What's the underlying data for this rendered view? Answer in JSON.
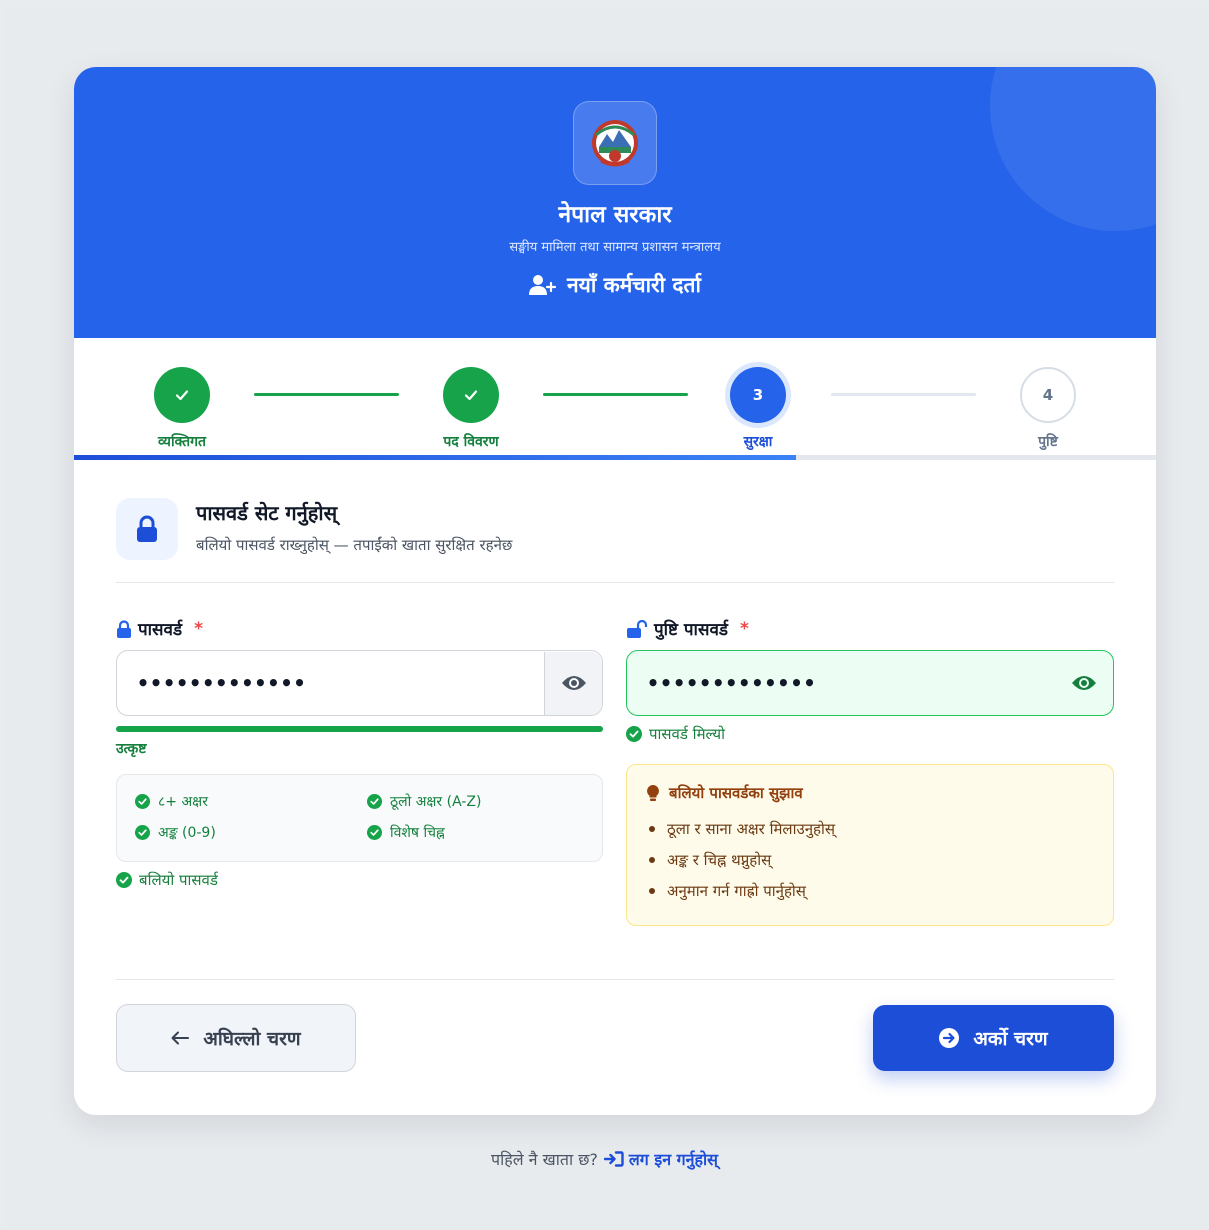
{
  "header": {
    "title": "नेपाल सरकार",
    "subtitle": "सङ्घीय मामिला तथा सामान्य प्रशासन मन्त्रालय",
    "registration_label": "नयाँ कर्मचारी दर्ता"
  },
  "stepper": {
    "progress_fraction": 0.667,
    "steps": [
      {
        "number": "1",
        "label": "व्यक्तिगत",
        "state": "done"
      },
      {
        "number": "2",
        "label": "पद विवरण",
        "state": "done"
      },
      {
        "number": "3",
        "label": "सुरक्षा",
        "state": "active"
      },
      {
        "number": "4",
        "label": "पुष्टि",
        "state": "todo"
      }
    ]
  },
  "section": {
    "title": "पासवर्ड सेट गर्नुहोस्",
    "subtitle": "बलियो पासवर्ड राख्नुहोस् — तपाईंको खाता सुरक्षित रहनेछ"
  },
  "password": {
    "label": "पासवर्ड",
    "required_mark": "*",
    "value_masked": "•••••••••••••",
    "strength_fraction": 1.0,
    "strength_label": "उत्कृष्ट",
    "checks": [
      {
        "label": "८+ अक्षर"
      },
      {
        "label": "ठूलो अक्षर (A-Z)"
      },
      {
        "label": "अङ्क (0-9)"
      },
      {
        "label": "विशेष चिह्न"
      }
    ],
    "status": "बलियो पासवर्ड"
  },
  "confirm": {
    "label": "पुष्टि पासवर्ड",
    "required_mark": "*",
    "value_masked": "•••••••••••••",
    "match_text": "पासवर्ड मिल्यो"
  },
  "tips": {
    "title": "बलियो पासवर्डका सुझाव",
    "items": [
      "ठूला र साना अक्षर मिलाउनुहोस्",
      "अङ्क र चिह्न थप्नुहोस्",
      "अनुमान गर्न गाह्रो पार्नुहोस्"
    ]
  },
  "actions": {
    "prev_label": "अघिल्लो चरण",
    "next_label": "अर्को चरण"
  },
  "footer": {
    "question": "पहिले नै खाता छ?",
    "login_label": "लग इन गर्नुहोस्"
  },
  "colors": {
    "primary": "#2563eb",
    "success": "#16a34a",
    "danger": "#ef4444",
    "warning_bg": "#fefbea"
  },
  "icons": {
    "emblem": "nepal-emblem",
    "register": "user-plus-icon",
    "lock": "lock-icon",
    "unlock": "unlock-icon",
    "eye": "eye-icon",
    "check": "check-circle-icon",
    "bulb": "lightbulb-icon",
    "prev": "arrow-left-icon",
    "next": "arrow-circle-right-icon",
    "login": "sign-in-icon"
  }
}
